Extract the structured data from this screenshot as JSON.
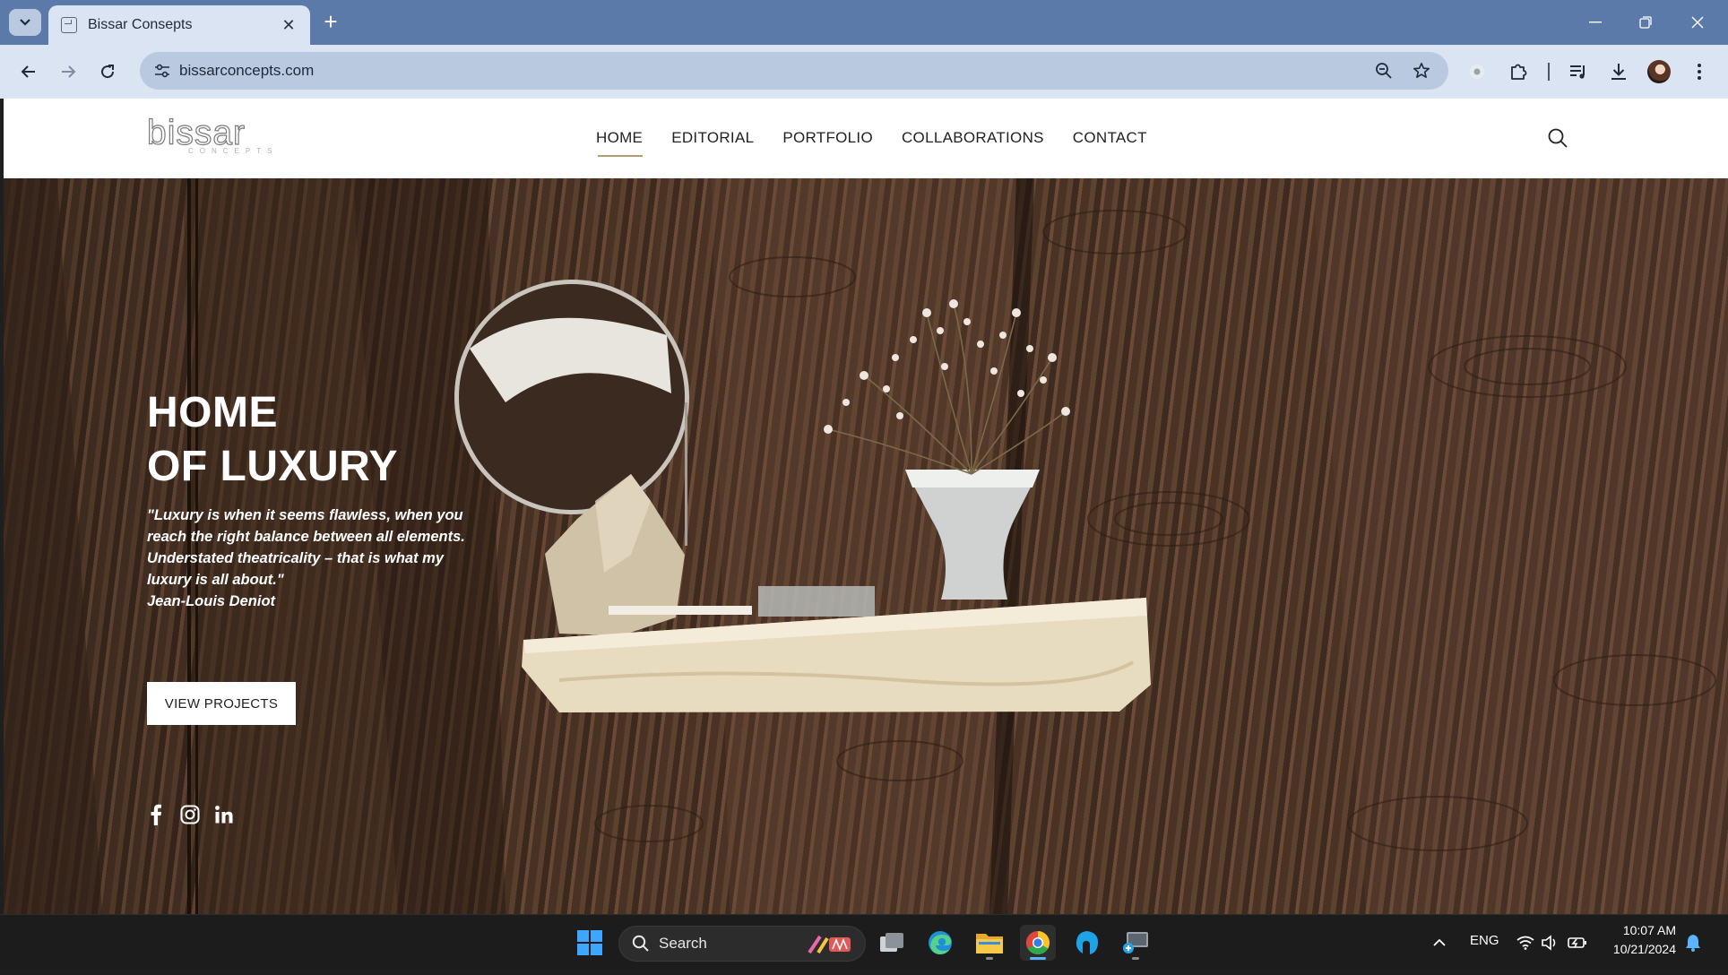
{
  "browser": {
    "tab_title": "Bissar Consepts",
    "url": "bissarconcepts.com"
  },
  "site": {
    "logo_text": "bissar",
    "logo_sub": "CONCEPTS",
    "nav": [
      {
        "label": "HOME",
        "active": true
      },
      {
        "label": "EDITORIAL",
        "active": false
      },
      {
        "label": "PORTFOLIO",
        "active": false
      },
      {
        "label": "COLLABORATIONS",
        "active": false
      },
      {
        "label": "CONTACT",
        "active": false
      }
    ]
  },
  "hero": {
    "title_line1": "HOME",
    "title_line2": "OF LUXURY",
    "quote_lines": [
      "\"Luxury is when it seems flawless, when you",
      "reach the right balance between all elements.",
      "Understated theatricality – that is what my",
      "luxury is all about.\"",
      "Jean-Louis Deniot"
    ],
    "cta_label": "VIEW PROJECTS",
    "socials": [
      "facebook-icon",
      "instagram-icon",
      "linkedin-icon"
    ]
  },
  "taskbar": {
    "search_label": "Search",
    "language": "ENG",
    "time": "10:07 AM",
    "date": "10/21/2024"
  },
  "colors": {
    "tabstrip": "#5b7aa9",
    "toolbar": "#dbe4f2",
    "omnibox": "#b9c9e0",
    "accent_underline": "#b59a6e",
    "taskbar": "#1c1c1c"
  }
}
